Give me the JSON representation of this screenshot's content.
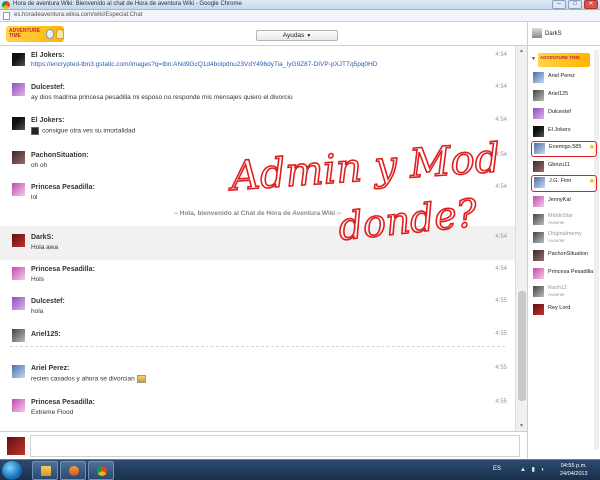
{
  "window": {
    "title": "Hora de aventura Wiki: Bienvenido al chat de Hora de aventura Wiki - Google Chrome",
    "url": "es.horadeaventura.wikia.com/wiki/Especial:Chat"
  },
  "header": {
    "logo_text": "ADVENTURE TIME",
    "help_label": "Ayudas",
    "help_caret": "▼",
    "current_user": "DarkS"
  },
  "chat": {
    "messages": [
      {
        "name": "El Jokers:",
        "time": "4:54",
        "text": "https://encrypted-tbn3.gstatic.com/images?q=tbn:ANd9GcQ1d4bolpdnu23VdY496dyTia_IyG9Z87-DIVP-pXJTTq5pq0HD",
        "avatar": "black"
      },
      {
        "name": "Dulcestef:",
        "time": "4:54",
        "text": "ay dios madrina princesa pesadilla mi esposo no responde mis mensajes quiero el divorcio",
        "avatar": "purple"
      },
      {
        "name": "El Jokers:",
        "time": "4:54",
        "text": "consigue otra ves su imortalidad",
        "avatar": "black"
      },
      {
        "name": "PachonSituation:",
        "time": "4:54",
        "text": "oh oh",
        "avatar": "dark"
      },
      {
        "name": "Princesa Pesadilla:",
        "time": "4:54",
        "text": "lol",
        "avatar": "pink"
      },
      {
        "name": "DarkS:",
        "time": "4:54",
        "text": "Hola awa",
        "avatar": "red"
      },
      {
        "name": "Princesa Pesadilla:",
        "time": "4:54",
        "text": "Hols",
        "avatar": "pink"
      },
      {
        "name": "Dulcestef:",
        "time": "4:55",
        "text": "hola",
        "avatar": "purple"
      },
      {
        "name": "Ariel125:",
        "time": "4:55",
        "text": "",
        "avatar": "gray"
      },
      {
        "name": "Ariel Perez:",
        "time": "4:55",
        "text": "recien casados y ahora se divorcian",
        "avatar": "blue"
      },
      {
        "name": "Princesa Pesadilla:",
        "time": "4:55",
        "text": "Extreme Flood",
        "avatar": "pink"
      }
    ],
    "join_alert": "-- Hola, bienvenido al Chat de Hora de Aventura Wiki --"
  },
  "input": {
    "value": ""
  },
  "user_list": {
    "logo_text": "ADVENTURE TIME",
    "users": [
      {
        "name": "Ariel Perez",
        "status": "",
        "avatar": "blue",
        "star": ""
      },
      {
        "name": "Ariel125",
        "status": "",
        "avatar": "gray",
        "star": ""
      },
      {
        "name": "Dulcestef",
        "status": "",
        "avatar": "purple",
        "star": ""
      },
      {
        "name": "El Jokers",
        "status": "",
        "avatar": "black",
        "star": ""
      },
      {
        "name": "Enemigo.585",
        "status": "",
        "avatar": "blue",
        "star": "★"
      },
      {
        "name": "Gbrizu11",
        "status": "",
        "avatar": "dark",
        "star": ""
      },
      {
        "name": "J.G. Finn",
        "status": "",
        "avatar": "blue",
        "star": "★"
      },
      {
        "name": "JennyKat",
        "status": "",
        "avatar": "pink",
        "star": ""
      },
      {
        "name": "MiddnStar",
        "status": "Ausente",
        "avatar": "gray",
        "star": ""
      },
      {
        "name": "Originalmemy",
        "status": "Ausente",
        "avatar": "gray",
        "star": ""
      },
      {
        "name": "PachonSituation",
        "status": "",
        "avatar": "dark",
        "star": ""
      },
      {
        "name": "Princesa Pesadilla",
        "status": "",
        "avatar": "pink",
        "star": ""
      },
      {
        "name": "Rash12",
        "status": "Ausente",
        "avatar": "gray",
        "star": ""
      },
      {
        "name": "Rey Lord",
        "status": "",
        "avatar": "red",
        "star": ""
      }
    ]
  },
  "taskbar": {
    "language": "ES",
    "time": "04:55 p.m.",
    "date": "24/04/2013"
  },
  "handwriting": {
    "line1": "Admin y Mod",
    "line2": "donde?"
  },
  "colors": {
    "annotation_red": "#e02020",
    "link_blue": "#2a5db0"
  }
}
